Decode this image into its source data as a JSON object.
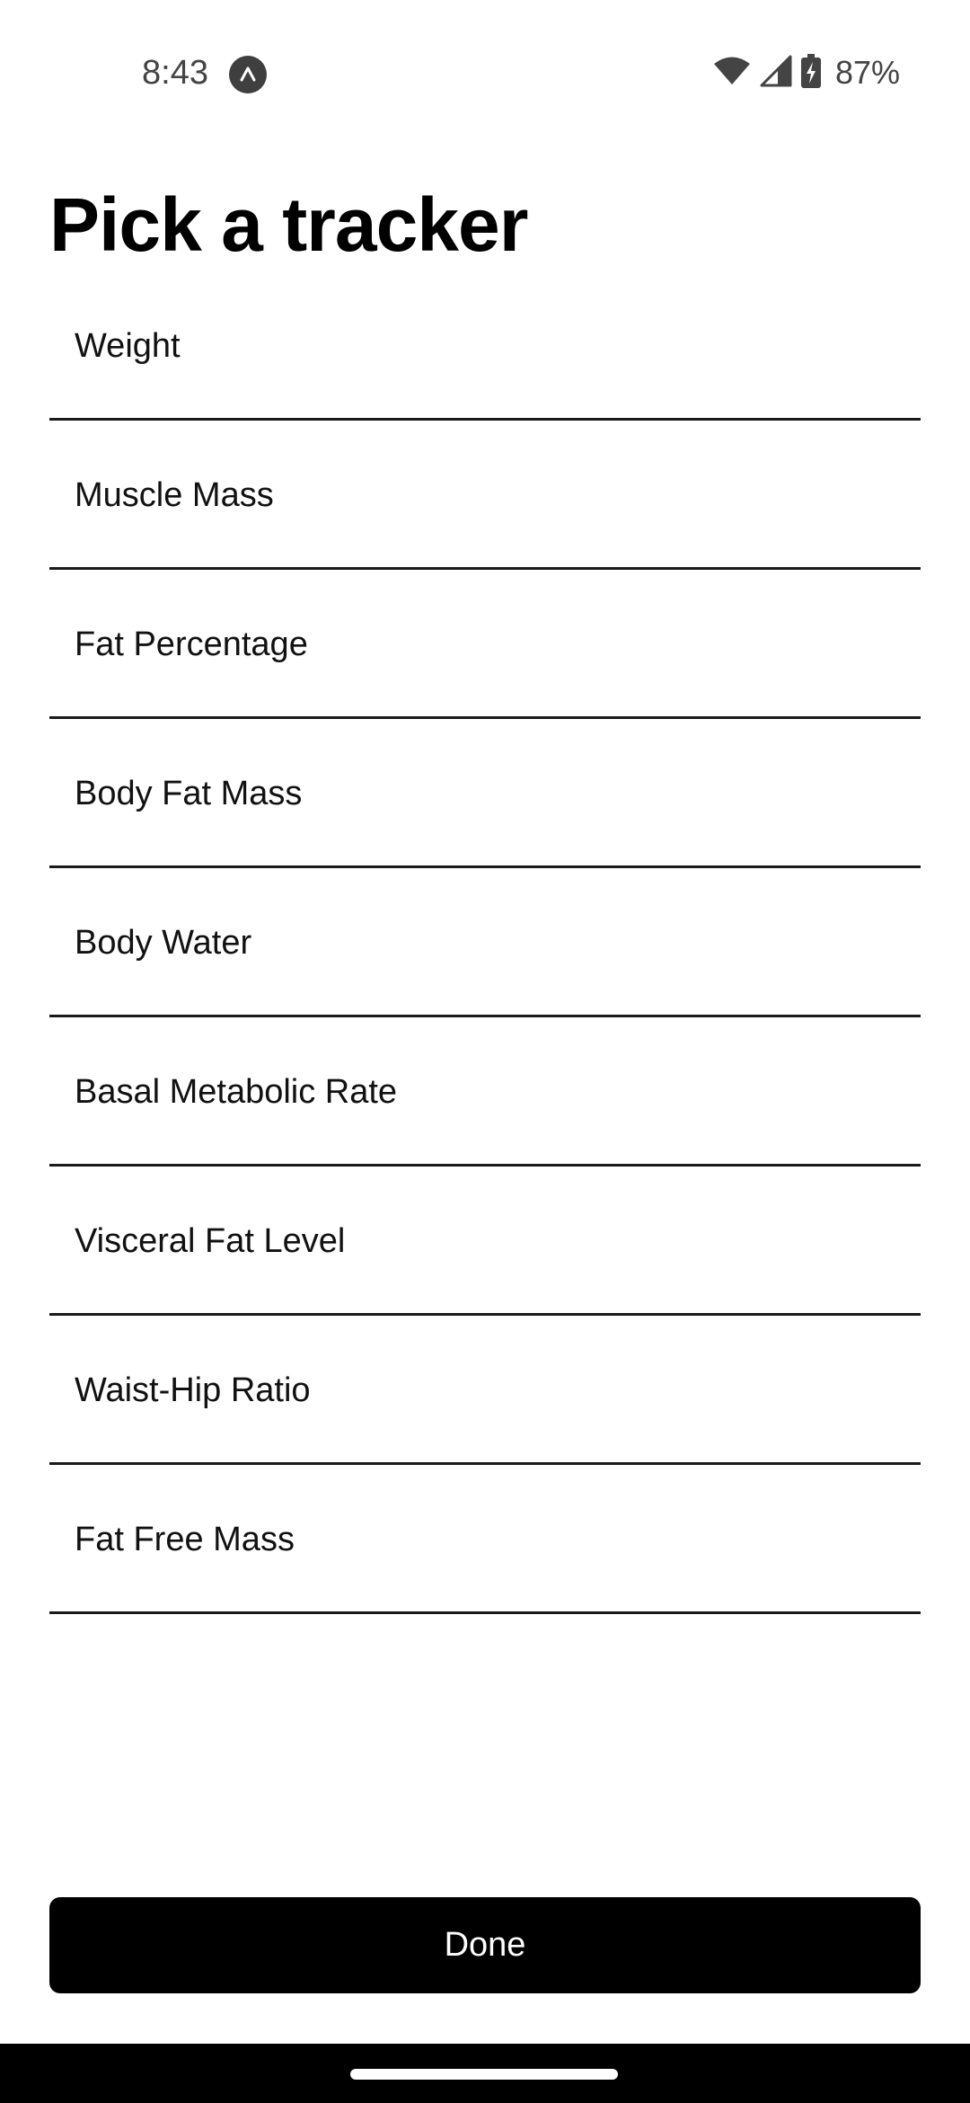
{
  "status_bar": {
    "time": "8:43",
    "app_icon": "app-logo-icon",
    "wifi_icon": "wifi-icon",
    "signal_icon": "signal-icon",
    "battery_icon": "battery-charging-icon",
    "battery_percent": "87%"
  },
  "page": {
    "title": "Pick a tracker"
  },
  "trackers": [
    {
      "label": "Weight"
    },
    {
      "label": "Muscle Mass"
    },
    {
      "label": "Fat Percentage"
    },
    {
      "label": "Body Fat Mass"
    },
    {
      "label": "Body Water"
    },
    {
      "label": "Basal Metabolic Rate"
    },
    {
      "label": "Visceral Fat Level"
    },
    {
      "label": "Waist-Hip Ratio"
    },
    {
      "label": "Fat Free Mass"
    }
  ],
  "actions": {
    "done_label": "Done"
  },
  "colors": {
    "background": "#ffffff",
    "text": "#000000",
    "divider": "#1a1a1a",
    "button_bg": "#000000",
    "button_text": "#ffffff"
  }
}
